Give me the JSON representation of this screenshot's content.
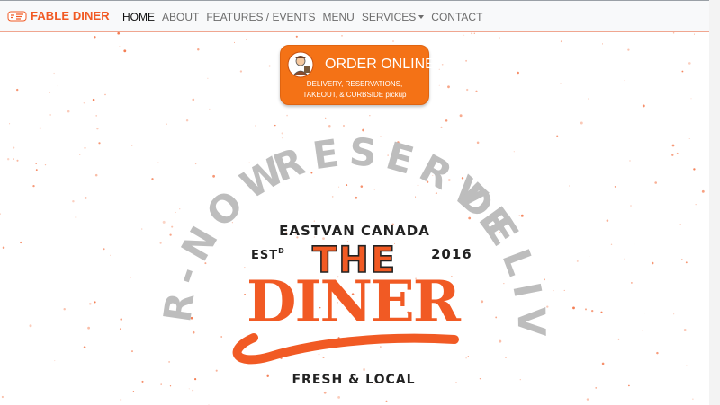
{
  "brand": {
    "name": "FABLE DINER"
  },
  "nav": {
    "items": [
      {
        "label": "HOME",
        "active": true
      },
      {
        "label": "ABOUT"
      },
      {
        "label": "FEATURES / EVENTS"
      },
      {
        "label": "MENU"
      },
      {
        "label": "SERVICES",
        "dropdown": true
      },
      {
        "label": "CONTACT"
      }
    ]
  },
  "order": {
    "title": "ORDER ONLINE",
    "subtitle_line1": "DELIVERY, RESERVATIONS,",
    "subtitle_line2": "TAKEOUT, & CURBSIDE pickup"
  },
  "hero": {
    "arc_top": "RESERVE",
    "arc_left": "R-NOW",
    "arc_right": "DELIV",
    "location": "EASTVAN CANADA",
    "est_label": "EST",
    "est_sup": "D",
    "year": "2016",
    "the": "THE",
    "diner": "DINER",
    "tagline": "FRESH & LOCAL"
  },
  "colors": {
    "accent": "#f15a24",
    "button": "#f47216",
    "arc": "#bdbdbd"
  }
}
